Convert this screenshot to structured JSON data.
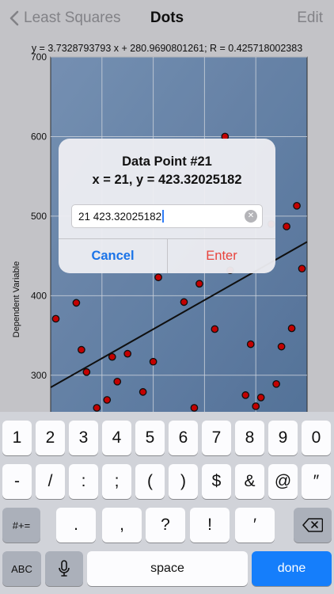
{
  "nav": {
    "back_label": "Least Squares",
    "title": "Dots",
    "edit_label": "Edit"
  },
  "equation": "y = 3.7328793793 x + 280.9690801261; R = 0.425718002383",
  "chart_data": {
    "type": "scatter",
    "ylabel": "Dependent Variable",
    "y_ticks": [
      "300",
      "400",
      "500",
      "600",
      "700"
    ],
    "ylim": [
      250,
      700
    ],
    "xlim": [
      0,
      50
    ],
    "points": [
      {
        "x": 1,
        "y": 371
      },
      {
        "x": 5,
        "y": 391
      },
      {
        "x": 6,
        "y": 332
      },
      {
        "x": 7,
        "y": 304
      },
      {
        "x": 9,
        "y": 259
      },
      {
        "x": 11,
        "y": 269
      },
      {
        "x": 12,
        "y": 323
      },
      {
        "x": 13,
        "y": 292
      },
      {
        "x": 15,
        "y": 327
      },
      {
        "x": 18,
        "y": 279
      },
      {
        "x": 20,
        "y": 317
      },
      {
        "x": 21,
        "y": 423
      },
      {
        "x": 26,
        "y": 392
      },
      {
        "x": 28,
        "y": 259
      },
      {
        "x": 29,
        "y": 415
      },
      {
        "x": 32,
        "y": 358
      },
      {
        "x": 34,
        "y": 600
      },
      {
        "x": 35,
        "y": 432
      },
      {
        "x": 38,
        "y": 275
      },
      {
        "x": 39,
        "y": 339
      },
      {
        "x": 40,
        "y": 261
      },
      {
        "x": 41,
        "y": 272
      },
      {
        "x": 43,
        "y": 490
      },
      {
        "x": 44,
        "y": 289
      },
      {
        "x": 45,
        "y": 336
      },
      {
        "x": 46,
        "y": 487
      },
      {
        "x": 47,
        "y": 359
      },
      {
        "x": 48,
        "y": 513
      },
      {
        "x": 49,
        "y": 434
      }
    ],
    "fit": {
      "slope": 3.7328793793,
      "intercept": 280.9690801261
    },
    "grid": true,
    "colors": {
      "background_top": "#7f9cc1",
      "background_bottom": "#5b7ca6",
      "point_fill": "#d40000",
      "point_stroke": "#111111",
      "line": "#111111",
      "grid": "#dfe6ef"
    }
  },
  "alert": {
    "title": "Data Point #21",
    "message": "x = 21, y = 423.32025182",
    "field_value": "21 423.32025182",
    "cancel_label": "Cancel",
    "enter_label": "Enter",
    "clear_icon": "clear-icon"
  },
  "keyboard": {
    "row1": [
      "1",
      "2",
      "3",
      "4",
      "5",
      "6",
      "7",
      "8",
      "9",
      "0"
    ],
    "row2": [
      "-",
      "/",
      ":",
      ";",
      "(",
      ")",
      "$",
      "&",
      "@",
      "″"
    ],
    "row3": [
      ".",
      ",",
      "?",
      "!",
      "′"
    ],
    "symbols_label": "#+=",
    "abc_label": "ABC",
    "space_label": "space",
    "done_label": "done"
  }
}
